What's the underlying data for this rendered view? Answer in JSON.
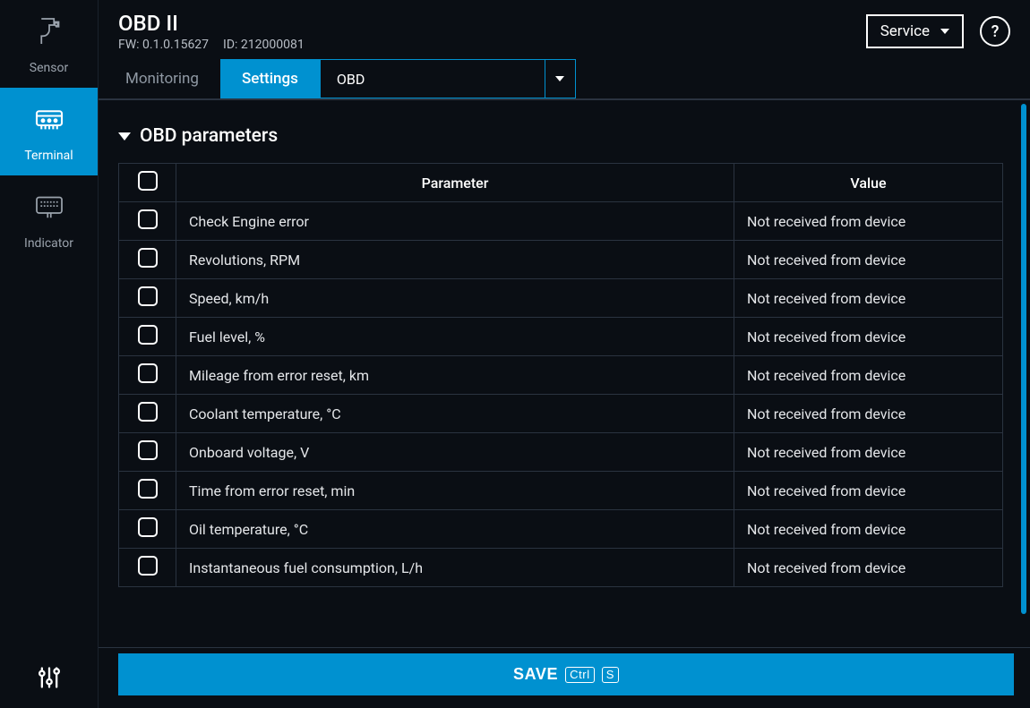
{
  "sidenav": {
    "items": [
      {
        "label": "Sensor"
      },
      {
        "label": "Terminal"
      },
      {
        "label": "Indicator"
      }
    ]
  },
  "header": {
    "title": "OBD II",
    "fw_label": "FW: 0.1.0.15627",
    "id_label": "ID: 212000081",
    "service_label": "Service",
    "help_label": "?"
  },
  "tabs": {
    "monitoring": "Monitoring",
    "settings": "Settings",
    "dropdown_value": "OBD"
  },
  "section": {
    "title": "OBD parameters"
  },
  "table": {
    "col_parameter": "Parameter",
    "col_value": "Value",
    "rows": [
      {
        "param": "Check Engine error",
        "value": "Not received from device"
      },
      {
        "param": "Revolutions, RPM",
        "value": "Not received from device"
      },
      {
        "param": "Speed, km/h",
        "value": "Not received from device"
      },
      {
        "param": "Fuel level, %",
        "value": "Not received from device"
      },
      {
        "param": "Mileage from error reset, km",
        "value": "Not received from device"
      },
      {
        "param": "Coolant temperature, °C",
        "value": "Not received from device"
      },
      {
        "param": "Onboard voltage, V",
        "value": "Not received from device"
      },
      {
        "param": "Time from error reset, min",
        "value": "Not received from device"
      },
      {
        "param": "Oil temperature, °C",
        "value": "Not received from device"
      },
      {
        "param": "Instantaneous fuel consumption, L/h",
        "value": "Not received from device"
      }
    ]
  },
  "save": {
    "label": "SAVE",
    "kbd1": "Ctrl",
    "kbd2": "S"
  }
}
